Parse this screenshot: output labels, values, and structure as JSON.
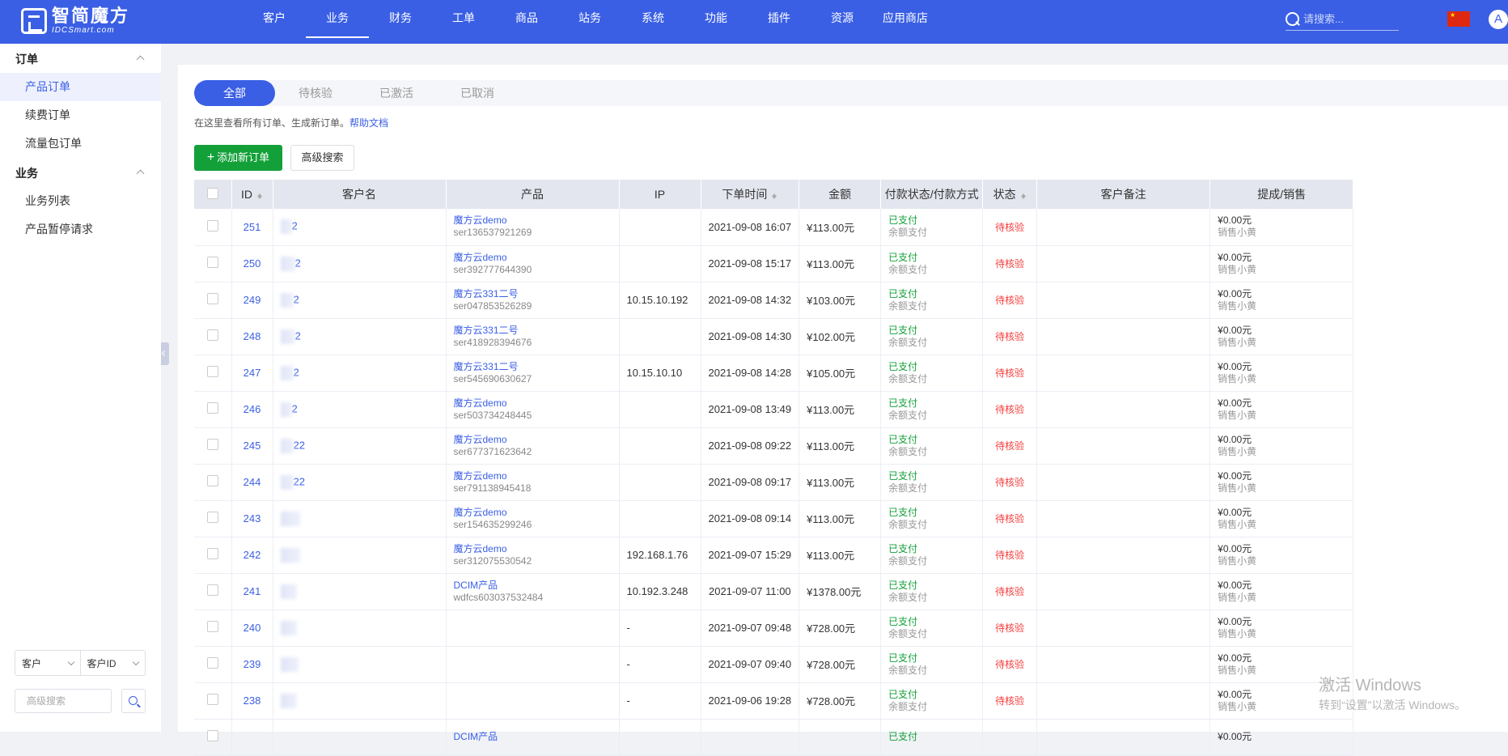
{
  "logo": {
    "name": "智简魔方",
    "sub": "IDCSmart.com"
  },
  "nav": [
    "客户",
    "业务",
    "财务",
    "工单",
    "商品",
    "站务",
    "系统",
    "功能",
    "插件",
    "资源",
    "应用商店"
  ],
  "nav_active": 1,
  "search_placeholder": "请搜索...",
  "avatar_letter": "A",
  "sidebar": {
    "groups": [
      {
        "title": "订单",
        "items": [
          "产品订单",
          "续费订单",
          "流量包订单"
        ]
      },
      {
        "title": "业务",
        "items": [
          "业务列表",
          "产品暂停请求"
        ]
      }
    ],
    "filter": {
      "select1": "客户",
      "select2": "客户ID",
      "search_placeholder": "高级搜索"
    }
  },
  "tabs": [
    "全部",
    "待核验",
    "已激活",
    "已取消"
  ],
  "description": "在这里查看所有订单、生成新订单。",
  "help_link": "帮助文档",
  "add_button": "添加新订单",
  "adv_search_button": "高级搜索",
  "table": {
    "headers": [
      "ID",
      "客户名",
      "产品",
      "IP",
      "下单时间",
      "金额",
      "付款状态/付款方式",
      "状态",
      "客户备注",
      "提成/销售"
    ],
    "rows": [
      {
        "id": "251",
        "client_suffix": "2",
        "product": "魔方云demo",
        "product_sub": "ser136537921269",
        "ip": "",
        "time": "2021-09-08 16:07",
        "amount": "¥113.00元",
        "pay": "已支付",
        "pay_method": "余额支付",
        "status": "待核验",
        "comm": "¥0.00元",
        "sales": "销售小黄"
      },
      {
        "id": "250",
        "client_suffix": "2",
        "product": "魔方云demo",
        "product_sub": "ser392777644390",
        "ip": "",
        "time": "2021-09-08 15:17",
        "amount": "¥113.00元",
        "pay": "已支付",
        "pay_method": "余额支付",
        "status": "待核验",
        "comm": "¥0.00元",
        "sales": "销售小黄"
      },
      {
        "id": "249",
        "client_suffix": "2",
        "product": "魔方云331二号",
        "product_sub": "ser047853526289",
        "ip": "10.15.10.192",
        "time": "2021-09-08 14:32",
        "amount": "¥103.00元",
        "pay": "已支付",
        "pay_method": "余额支付",
        "status": "待核验",
        "comm": "¥0.00元",
        "sales": "销售小黄"
      },
      {
        "id": "248",
        "client_suffix": "2",
        "product": "魔方云331二号",
        "product_sub": "ser418928394676",
        "ip": "",
        "time": "2021-09-08 14:30",
        "amount": "¥102.00元",
        "pay": "已支付",
        "pay_method": "余额支付",
        "status": "待核验",
        "comm": "¥0.00元",
        "sales": "销售小黄"
      },
      {
        "id": "247",
        "client_suffix": "2",
        "product": "魔方云331二号",
        "product_sub": "ser545690630627",
        "ip": "10.15.10.10",
        "time": "2021-09-08 14:28",
        "amount": "¥105.00元",
        "pay": "已支付",
        "pay_method": "余额支付",
        "status": "待核验",
        "comm": "¥0.00元",
        "sales": "销售小黄"
      },
      {
        "id": "246",
        "client_suffix": "2",
        "product": "魔方云demo",
        "product_sub": "ser503734248445",
        "ip": "",
        "time": "2021-09-08 13:49",
        "amount": "¥113.00元",
        "pay": "已支付",
        "pay_method": "余额支付",
        "status": "待核验",
        "comm": "¥0.00元",
        "sales": "销售小黄"
      },
      {
        "id": "245",
        "client_suffix": "22",
        "product": "魔方云demo",
        "product_sub": "ser677371623642",
        "ip": "",
        "time": "2021-09-08 09:22",
        "amount": "¥113.00元",
        "pay": "已支付",
        "pay_method": "余额支付",
        "status": "待核验",
        "comm": "¥0.00元",
        "sales": "销售小黄"
      },
      {
        "id": "244",
        "client_suffix": "22",
        "product": "魔方云demo",
        "product_sub": "ser791138945418",
        "ip": "",
        "time": "2021-09-08 09:17",
        "amount": "¥113.00元",
        "pay": "已支付",
        "pay_method": "余额支付",
        "status": "待核验",
        "comm": "¥0.00元",
        "sales": "销售小黄"
      },
      {
        "id": "243",
        "client_suffix": "",
        "product": "魔方云demo",
        "product_sub": "ser154635299246",
        "ip": "",
        "time": "2021-09-08 09:14",
        "amount": "¥113.00元",
        "pay": "已支付",
        "pay_method": "余额支付",
        "status": "待核验",
        "comm": "¥0.00元",
        "sales": "销售小黄"
      },
      {
        "id": "242",
        "client_suffix": "",
        "product": "魔方云demo",
        "product_sub": "ser312075530542",
        "ip": "192.168.1.76",
        "time": "2021-09-07 15:29",
        "amount": "¥113.00元",
        "pay": "已支付",
        "pay_method": "余额支付",
        "status": "待核验",
        "comm": "¥0.00元",
        "sales": "销售小黄"
      },
      {
        "id": "241",
        "client_suffix": "",
        "product": "DCIM产品",
        "product_sub": "wdfcs603037532484",
        "ip": "10.192.3.248",
        "time": "2021-09-07 11:00",
        "amount": "¥1378.00元",
        "pay": "已支付",
        "pay_method": "余额支付",
        "status": "待核验",
        "comm": "¥0.00元",
        "sales": "销售小黄"
      },
      {
        "id": "240",
        "client_suffix": "",
        "product": "",
        "product_sub": "",
        "ip": "-",
        "time": "2021-09-07 09:48",
        "amount": "¥728.00元",
        "pay": "已支付",
        "pay_method": "余额支付",
        "status": "待核验",
        "comm": "¥0.00元",
        "sales": "销售小黄"
      },
      {
        "id": "239",
        "client_suffix": "",
        "product": "",
        "product_sub": "",
        "ip": "-",
        "time": "2021-09-07 09:40",
        "amount": "¥728.00元",
        "pay": "已支付",
        "pay_method": "余额支付",
        "status": "待核验",
        "comm": "¥0.00元",
        "sales": "销售小黄"
      },
      {
        "id": "238",
        "client_suffix": "",
        "product": "",
        "product_sub": "",
        "ip": "-",
        "time": "2021-09-06 19:28",
        "amount": "¥728.00元",
        "pay": "已支付",
        "pay_method": "余额支付",
        "status": "待核验",
        "comm": "¥0.00元",
        "sales": "销售小黄"
      },
      {
        "id": "",
        "client_suffix": "",
        "product": "DCIM产品",
        "product_sub": "",
        "ip": "",
        "time": "",
        "amount": "",
        "pay": "已支付",
        "pay_method": "",
        "status": "",
        "comm": "¥0.00元",
        "sales": ""
      }
    ]
  },
  "watermark": {
    "line1": "激活 Windows",
    "line2": "转到“设置”以激活 Windows。"
  }
}
